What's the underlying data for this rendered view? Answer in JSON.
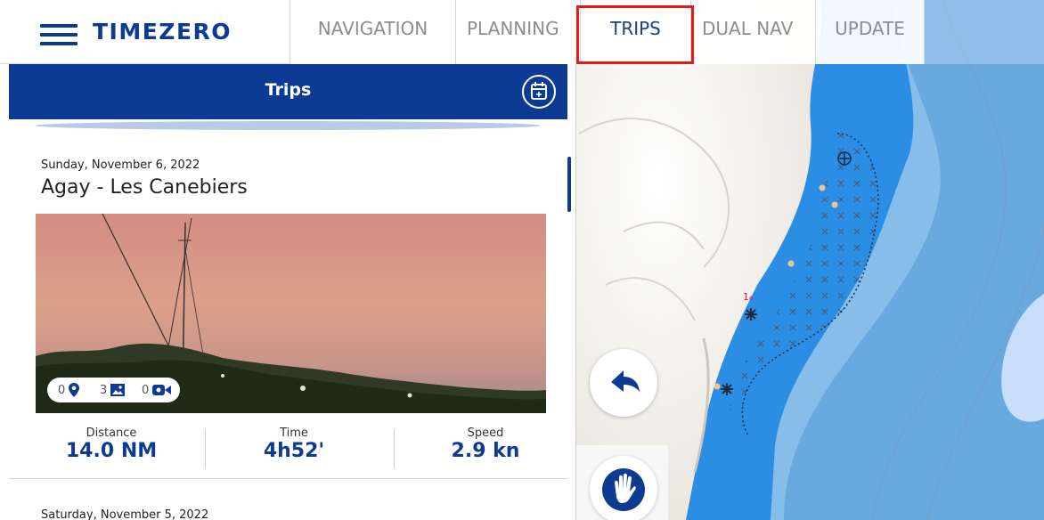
{
  "app": {
    "brand": "TIMEZERO"
  },
  "tabs": [
    {
      "label": "NAVIGATION"
    },
    {
      "label": "PLANNING"
    },
    {
      "label": "TRIPS"
    },
    {
      "label": "DUAL NAV"
    },
    {
      "label": "UPDATE"
    }
  ],
  "active_tab": "TRIPS",
  "panel": {
    "title": "Trips"
  },
  "trips": [
    {
      "date": "Sunday, November 6, 2022",
      "title": "Agay - Les Canebiers",
      "counts": {
        "waypoints": "0",
        "photos": "3",
        "videos": "0"
      },
      "stats": {
        "distance_label": "Distance",
        "distance_value": "14.0 NM",
        "time_label": "Time",
        "time_value": "4h52'",
        "speed_label": "Speed",
        "speed_value": "2.9 kn"
      }
    },
    {
      "date": "Saturday, November 5, 2022"
    }
  ],
  "map": {
    "depth_marker": "1₆"
  },
  "colors": {
    "brand": "#0d3b93",
    "highlight": "#e21b1b",
    "sea_shallow": "#2b8ee4",
    "sea_mid": "#6aa9e0",
    "sea_deep": "#86bde9",
    "land": "#f4f1ea"
  },
  "icons": [
    "menu-icon",
    "calendar-icon",
    "location-pin-icon",
    "photo-icon",
    "video-icon",
    "back-arrow-icon",
    "hand-icon"
  ]
}
